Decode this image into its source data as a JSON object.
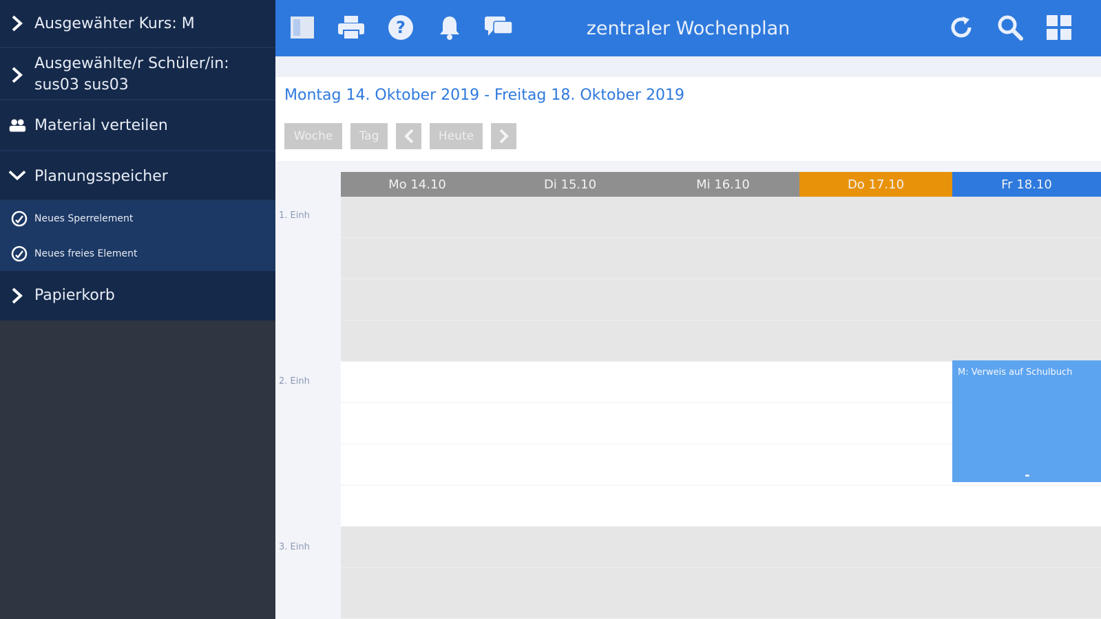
{
  "sidebar": {
    "items": [
      {
        "label": "Ausgewähter Kurs: M",
        "icon": "chevron-right-icon"
      },
      {
        "label": "Ausgewählte/r Schüler/in:",
        "label2": "sus03 sus03",
        "icon": "chevron-right-icon"
      },
      {
        "label": "Material verteilen",
        "icon": "users-icon"
      },
      {
        "label": "Planungsspeicher",
        "icon": "chevron-down-icon"
      },
      {
        "label": "Papierkorb",
        "icon": "chevron-right-icon"
      }
    ],
    "subitems": [
      {
        "label": "Neues Sperrelement",
        "icon": "block-icon"
      },
      {
        "label": "Neues freies Element",
        "icon": "block-icon"
      }
    ]
  },
  "topbar": {
    "title": "zentraler Wochenplan",
    "icons_left": [
      "sidebar-toggle-icon",
      "print-icon",
      "help-icon",
      "bell-icon",
      "chat-icon"
    ],
    "icons_right": [
      "refresh-icon",
      "search-icon",
      "grid-icon"
    ]
  },
  "main": {
    "date_range": "Montag 14. Oktober 2019 - Freitag 18. Oktober 2019",
    "nav": {
      "week": "Woche",
      "day": "Tag",
      "today": "Heute"
    },
    "days": [
      {
        "label": "Mo 14.10",
        "state": "normal"
      },
      {
        "label": "Di 15.10",
        "state": "normal"
      },
      {
        "label": "Mi 16.10",
        "state": "normal"
      },
      {
        "label": "Do 17.10",
        "state": "today"
      },
      {
        "label": "Fr 18.10",
        "state": "selected"
      }
    ],
    "periods": [
      "1. Einh",
      "2. Einh",
      "3. Einh"
    ],
    "event": {
      "label": "M: Verweis auf Schulbuch",
      "day": "Fr 18.10",
      "period": "2. Einh"
    }
  },
  "colors": {
    "topbar": "#2e79dd",
    "sidebar": "#15294a",
    "today": "#e8920a",
    "selected_day": "#2e79dd",
    "event": "#5da4ef"
  }
}
